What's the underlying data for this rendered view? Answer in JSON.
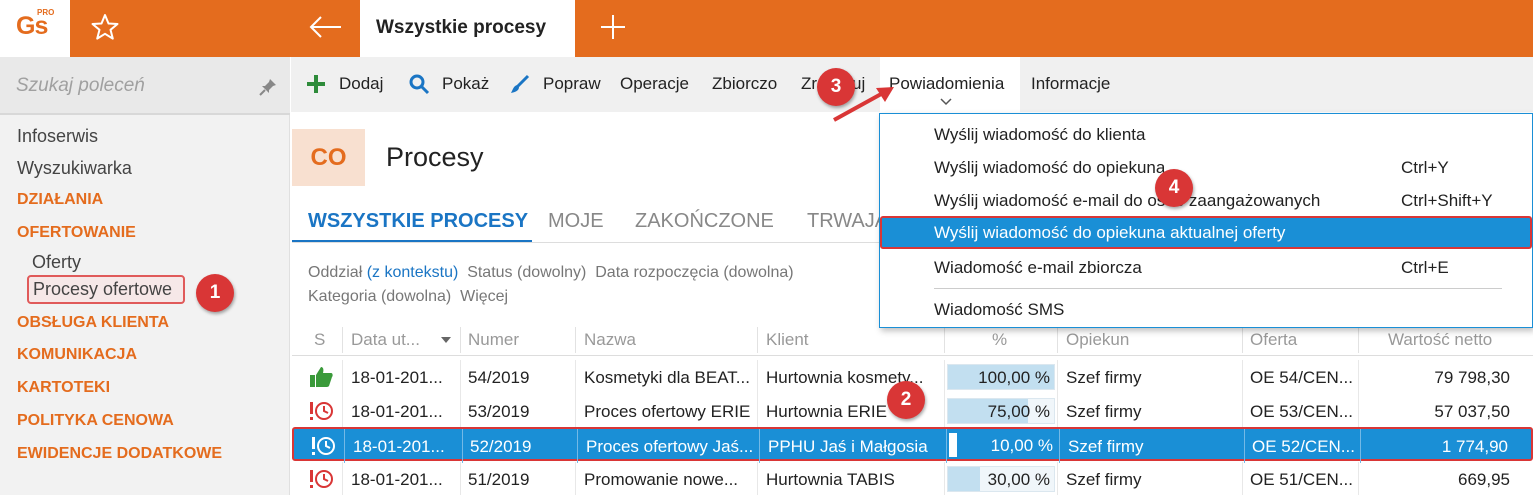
{
  "app": {
    "logo_text": "Gs",
    "logo_badge": "PRO",
    "title_tab": "Wszystkie procesy"
  },
  "sidebar": {
    "search_placeholder": "Szukaj poleceń",
    "links": [
      "Infoserwis",
      "Wyszukiwarka"
    ],
    "categories": [
      "DZIAŁANIA",
      "OFERTOWANIE",
      "OBSŁUGA KLIENTA",
      "KOMUNIKACJA",
      "KARTOTEKI",
      "POLITYKA CENOWA",
      "EWIDENCJE DODATKOWE"
    ],
    "sub_items": [
      "Oferty",
      "Procesy ofertowe"
    ]
  },
  "toolbar": {
    "add": "Dodaj",
    "show": "Pokaż",
    "edit": "Popraw",
    "operations": "Operacje",
    "bulk": "Zbiorczo",
    "execute": "Zrealizuj",
    "notifications": "Powiadomienia",
    "info": "Informacje"
  },
  "module": {
    "code": "CO",
    "title": "Procesy"
  },
  "list_tabs": [
    "WSZYSTKIE PROCESY",
    "MOJE",
    "ZAKOŃCZONE",
    "TRWAJĄ"
  ],
  "filters": {
    "branch": "Oddział",
    "branch_ctx": "(z kontekstu)",
    "status": "Status (dowolny)",
    "start_date": "Data rozpoczęcia (dowolna)",
    "category": "Kategoria (dowolna)",
    "more": "Więcej"
  },
  "grid": {
    "columns": [
      "S",
      "Data ut...",
      "Numer",
      "Nazwa",
      "Klient",
      "%",
      "Opiekun",
      "Oferta",
      "Wartość netto"
    ],
    "rows": [
      {
        "status": "thumbs-up",
        "date": "18-01-201...",
        "number": "54/2019",
        "name": "Kosmetyki dla BEAT...",
        "client": "Hurtownia kosmety...",
        "percent": "100,00 %",
        "percent_value": 100,
        "owner": "Szef firmy",
        "offer": "OE 54/CEN...",
        "net": "79 798,30"
      },
      {
        "status": "alert-clock",
        "date": "18-01-201...",
        "number": "53/2019",
        "name": "Proces ofertowy ERIE",
        "client": "Hurtownia ERIE",
        "percent": "75,00 %",
        "percent_value": 75,
        "owner": "Szef firmy",
        "offer": "OE 53/CEN...",
        "net": "57 037,50"
      },
      {
        "status": "alert-clock",
        "date": "18-01-201...",
        "number": "52/2019",
        "name": "Proces ofertowy Jaś...",
        "client": "PPHU Jaś i Małgosia",
        "percent": "10,00 %",
        "percent_value": 10,
        "owner": "Szef firmy",
        "offer": "OE 52/CEN...",
        "net": "1 774,90"
      },
      {
        "status": "alert-clock",
        "date": "18-01-201...",
        "number": "51/2019",
        "name": "Promowanie nowe...",
        "client": "Hurtownia TABIS",
        "percent": "30,00 %",
        "percent_value": 30,
        "owner": "Szef firmy",
        "offer": "OE 51/CEN...",
        "net": "669,95"
      }
    ]
  },
  "dropdown": {
    "items": [
      {
        "label": "Wyślij wiadomość do klienta",
        "shortcut": ""
      },
      {
        "label": "Wyślij wiadomość do opiekuna",
        "shortcut": "Ctrl+Y"
      },
      {
        "label": "Wyślij wiadomość e-mail do osób zaangażowanych",
        "shortcut": "Ctrl+Shift+Y"
      },
      {
        "label": "Wyślij wiadomość do opiekuna aktualnej oferty",
        "shortcut": ""
      },
      {
        "label": "Wiadomość e-mail zbiorcza",
        "shortcut": "Ctrl+E"
      },
      {
        "label": "Wiadomość SMS",
        "shortcut": ""
      }
    ]
  },
  "annotations": [
    "1",
    "2",
    "3",
    "4"
  ],
  "colors": {
    "brand": "#e46c1e",
    "selection": "#1a8fd6",
    "marker": "#d93636",
    "link": "#1a75c4"
  }
}
